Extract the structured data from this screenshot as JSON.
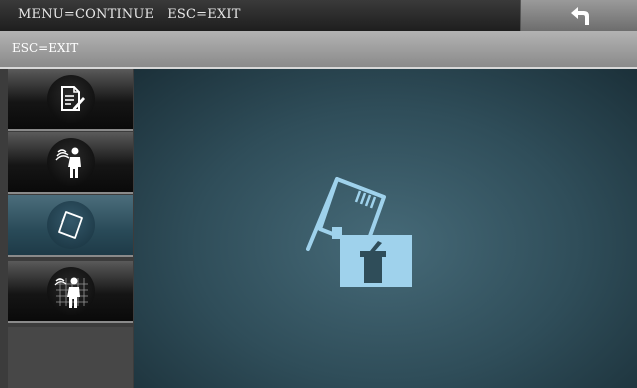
{
  "topbar": {
    "hint": "MENU=CONTINUE   ESC=EXIT",
    "back_icon": "return-arrow-icon"
  },
  "subbar": {
    "hint": "ESC=EXIT"
  },
  "sidebar": {
    "items": [
      {
        "icon": "document-edit-icon",
        "active": false
      },
      {
        "icon": "person-sensor-icon",
        "active": false
      },
      {
        "icon": "card-icon",
        "active": true
      },
      {
        "icon": "person-scan-icon",
        "active": false
      }
    ]
  },
  "main": {
    "icon": "card-delete-icon"
  },
  "colors": {
    "accent": "#9fd2ec",
    "active_item": "#294a58",
    "main_bg": "#2f4d59"
  }
}
